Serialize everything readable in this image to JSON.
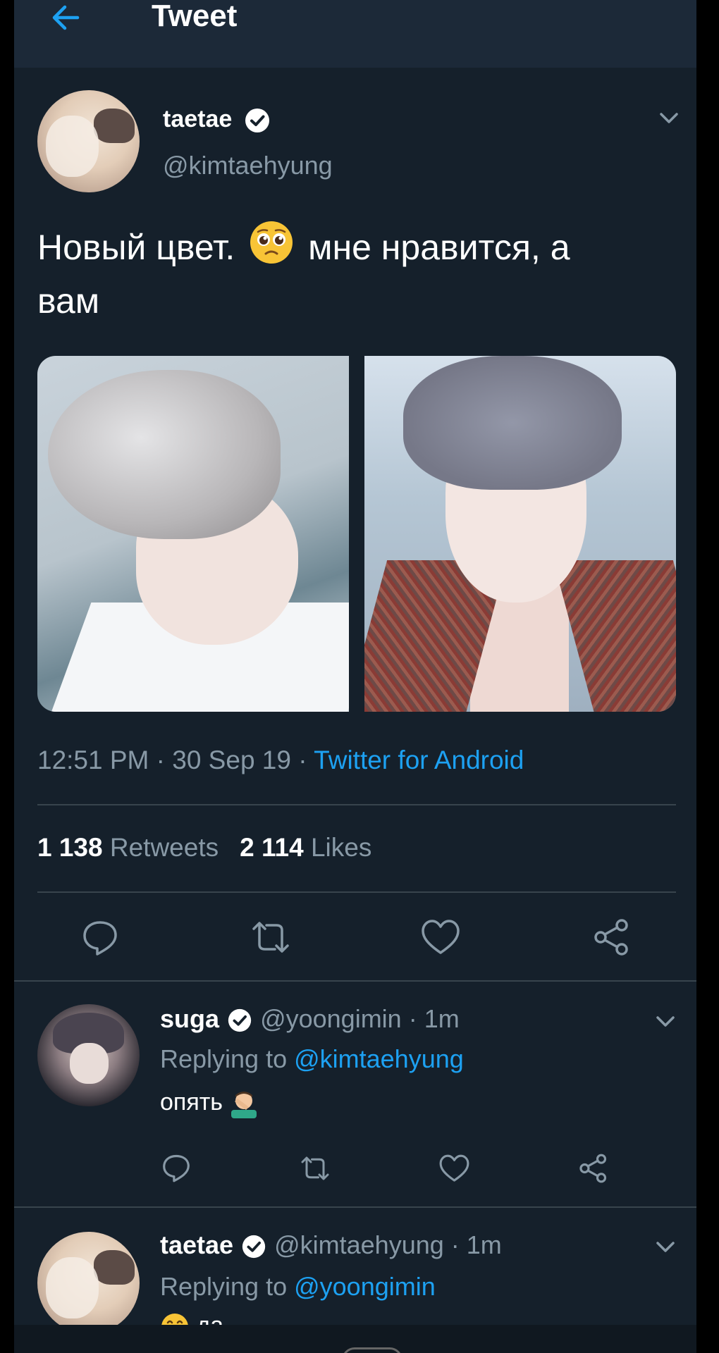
{
  "header": {
    "title": "Tweet",
    "back_icon": "arrow-left-icon"
  },
  "colors": {
    "background": "#15202b",
    "header": "#1c2938",
    "accent": "#1da1f2",
    "muted": "#8899a6",
    "divider": "#38444d"
  },
  "tweet": {
    "author_name": "taetae",
    "author_handle": "@kimtaehyung",
    "text_part1": "Новый цвет.",
    "emoji": "pleading-face-emoji",
    "text_part2": "мне нравится, а",
    "text_line2": "вам",
    "time_date": "12:51 PM · 30 Sep 19 · ",
    "source": "Twitter for Android",
    "retweets_count": "1 138",
    "retweets_label": "Retweets",
    "likes_count": "2 114",
    "likes_label": "Likes",
    "photo_count": 2
  },
  "replies": [
    {
      "author_name": "suga",
      "author_handle": "@yoongimin",
      "time": "· 1m",
      "replying_prefix": "Replying to ",
      "replying_to": "@kimtaehyung",
      "text": "опять",
      "emoji": "facepalm-emoji"
    },
    {
      "author_name": "taetae",
      "author_handle": "@kimtaehyung",
      "time": "· 1m",
      "replying_prefix": "Replying to ",
      "replying_to": "@yoongimin",
      "text": "да",
      "emoji": "grinning-emoji"
    }
  ]
}
